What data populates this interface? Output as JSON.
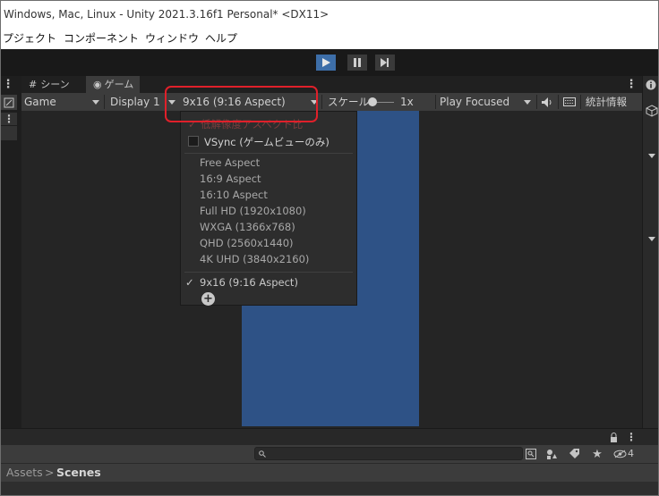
{
  "window": {
    "title": "Windows, Mac, Linux - Unity 2021.3.16f1 Personal* <DX11>"
  },
  "menu": {
    "items": [
      "プジェクト",
      "コンポーネント",
      "ウィンドウ",
      "ヘルプ"
    ]
  },
  "tabs": {
    "scene": "シーン",
    "game": "ゲーム"
  },
  "game_toolbar": {
    "view": "Game",
    "display": "Display 1",
    "aspect": "9x16 (9:16 Aspect)",
    "scale_label": "スケール",
    "scale_value": "1x",
    "play_mode": "Play Focused",
    "stats": "統計情報"
  },
  "aspect_dropdown": {
    "low_res_item": "低解像度アスペクト比",
    "vsync_item": "VSync (ゲームビューのみ)",
    "aspects": [
      "Free Aspect",
      "16:9 Aspect",
      "16:10 Aspect",
      "Full HD (1920x1080)",
      "WXGA (1366x768)",
      "QHD (2560x1440)",
      "4K UHD (3840x2160)"
    ],
    "selected_item": "9x16 (9:16 Aspect)",
    "check_mark": "✓",
    "add_glyph": "+"
  },
  "project": {
    "breadcrumb_root": "Assets",
    "breadcrumb_sep": ">",
    "breadcrumb_current": "Scenes",
    "hidden_count": "4"
  },
  "colors": {
    "play_active": "#3d6ea8",
    "game_view": "#2e5286",
    "highlight": "#e0202a"
  }
}
